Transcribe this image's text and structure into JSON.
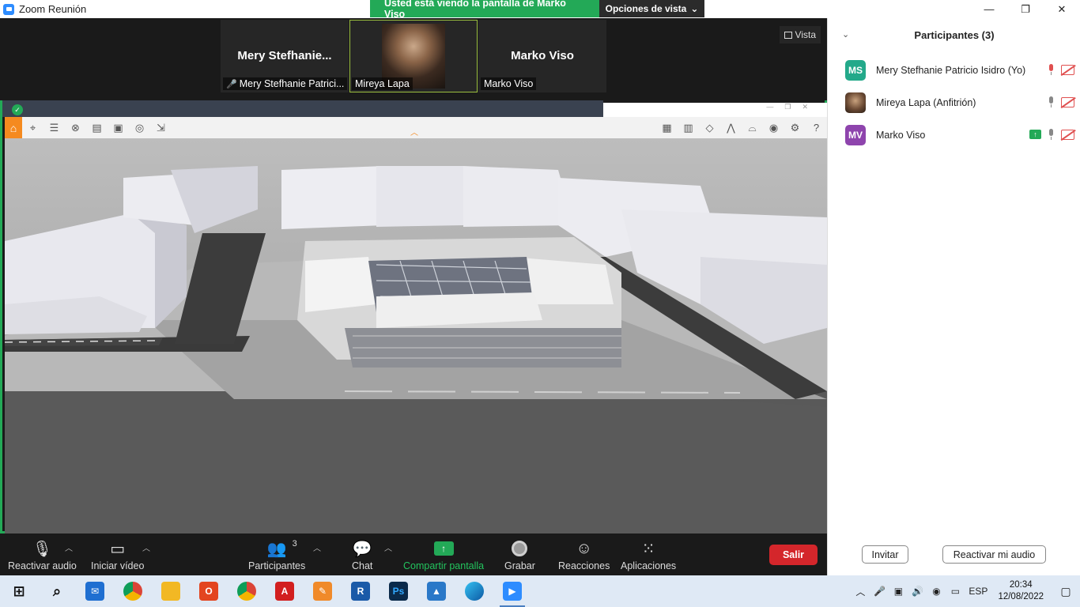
{
  "window": {
    "title": "Zoom Reunión",
    "minimize": "—",
    "restore": "❐",
    "close": "✕"
  },
  "sharing_banner": {
    "text": "Usted está viendo la pantalla de Marko Viso",
    "view_options": "Opciones de vista",
    "view_options_caret": "⌄"
  },
  "gallery": {
    "view_label": "Vista",
    "tiles": [
      {
        "big_name": "Mery  Stefhanie...",
        "label": "Mery Stefhanie Patrici..."
      },
      {
        "big_name": "",
        "label": "Mireya Lapa"
      },
      {
        "big_name": "Marko Viso",
        "label": "Marko Viso"
      }
    ]
  },
  "bottom_bar": {
    "audio": "Reactivar audio",
    "video": "Iniciar vídeo",
    "participants": "Participantes",
    "participants_count": "3",
    "chat": "Chat",
    "share": "Compartir pantalla",
    "record": "Grabar",
    "reactions": "Reacciones",
    "apps": "Aplicaciones",
    "leave": "Salir"
  },
  "panel": {
    "title": "Participantes (3)",
    "participants": [
      {
        "initials": "MS",
        "name": "Mery Stefhanie Patricio Isidro (Yo)",
        "color": "#23a98a"
      },
      {
        "initials": "",
        "name": "Mireya Lapa (Anfitrión)",
        "color": "#5a3a28"
      },
      {
        "initials": "MV",
        "name": "Marko Viso",
        "color": "#8e44ad"
      }
    ],
    "invite": "Invitar",
    "reactivate_audio": "Reactivar mi audio"
  },
  "taskbar": {
    "language": "ESP",
    "time": "20:34",
    "date": "12/08/2022"
  },
  "colors": {
    "zoom_green": "#23a957",
    "leave_red": "#d4262b",
    "toolbar_orange": "#f58a1f"
  }
}
